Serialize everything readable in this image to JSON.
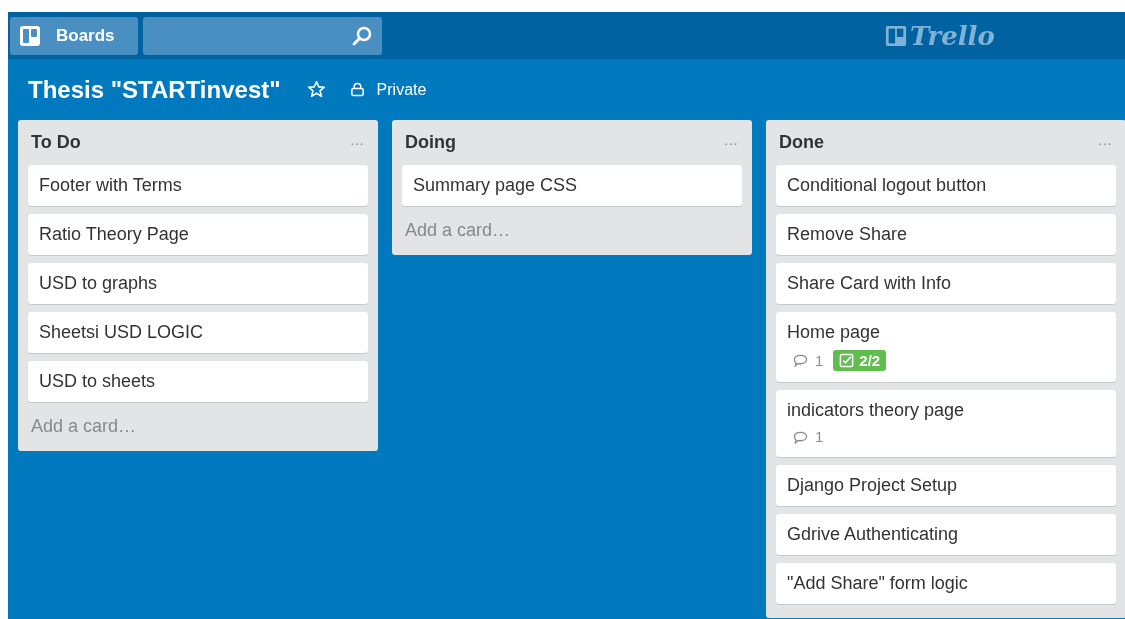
{
  "header": {
    "boards_button": "Boards",
    "logo": "Trello"
  },
  "board": {
    "title": "Thesis \"STARTinvest\"",
    "starred": false,
    "visibility": "Private"
  },
  "lists": [
    {
      "title": "To Do",
      "menu": "···",
      "cards": [
        {
          "title": "Footer with Terms"
        },
        {
          "title": "Ratio Theory Page"
        },
        {
          "title": "USD to graphs"
        },
        {
          "title": "Sheetsi USD LOGIC"
        },
        {
          "title": "USD to sheets"
        }
      ],
      "add_card": "Add a card…"
    },
    {
      "title": "Doing",
      "menu": "···",
      "cards": [
        {
          "title": "Summary page CSS"
        }
      ],
      "add_card": "Add a card…"
    },
    {
      "title": "Done",
      "menu": "···",
      "cards": [
        {
          "title": "Conditional logout button"
        },
        {
          "title": "Remove Share"
        },
        {
          "title": "Share Card with Info"
        },
        {
          "title": "Home page",
          "comments": "1",
          "checklist": {
            "text": "2/2",
            "complete": true
          }
        },
        {
          "title": "indicators theory page",
          "comments": "1"
        },
        {
          "title": "Django Project Setup"
        },
        {
          "title": "Gdrive Authenticating"
        },
        {
          "title": "\"Add Share\" form logic"
        }
      ]
    }
  ]
}
